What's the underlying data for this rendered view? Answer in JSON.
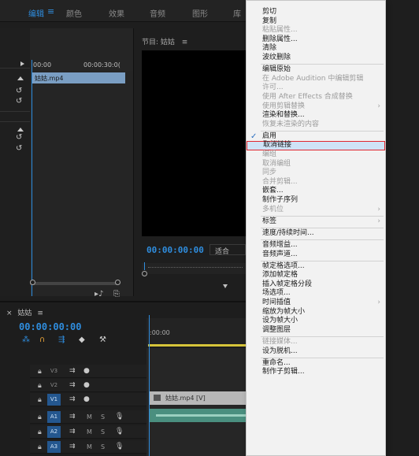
{
  "workspaces": {
    "items": [
      {
        "label": "编辑",
        "active": true
      },
      {
        "label": "颜色",
        "active": false
      },
      {
        "label": "效果",
        "active": false
      },
      {
        "label": "音频",
        "active": false
      },
      {
        "label": "图形",
        "active": false
      },
      {
        "label": "库",
        "active": false
      }
    ],
    "menu_icon": "≡"
  },
  "effect_controls": {
    "ruler_start": "00:00",
    "ruler_end": "00:00:30:0(",
    "clip_name": "姑姑.mp4"
  },
  "program_monitor": {
    "title": "节目: 姑姑",
    "menu_icon": "≡",
    "timecode": "00:00:00:00",
    "fit_label": "适合"
  },
  "timeline": {
    "tab_label": "姑姑",
    "tab_menu_icon": "≡",
    "close_icon": "×",
    "timecode": "00:00:00:00",
    "ruler_timecode": ":00:00",
    "tracks": [
      {
        "id": "V3",
        "type": "video",
        "targeted": false
      },
      {
        "id": "V2",
        "type": "video",
        "targeted": false
      },
      {
        "id": "V1",
        "type": "video",
        "targeted": true
      },
      {
        "id": "A1",
        "type": "audio",
        "targeted": true
      },
      {
        "id": "A2",
        "type": "audio",
        "targeted": true
      },
      {
        "id": "A3",
        "type": "audio",
        "targeted": true
      }
    ],
    "audio_mute_label": "M",
    "audio_solo_label": "S",
    "video_clip_label": "姑姑.mp4 [V]"
  },
  "context_menu": {
    "items": [
      {
        "label": "剪切",
        "enabled": true
      },
      {
        "label": "复制",
        "enabled": true
      },
      {
        "label": "粘贴属性...",
        "enabled": false
      },
      {
        "label": "删除属性...",
        "enabled": true
      },
      {
        "label": "清除",
        "enabled": true
      },
      {
        "label": "波纹删除",
        "enabled": true
      },
      {
        "separator": true
      },
      {
        "label": "编辑原始",
        "enabled": true
      },
      {
        "label": "在 Adobe Audition 中编辑剪辑",
        "enabled": false
      },
      {
        "label": "许可...",
        "enabled": false
      },
      {
        "label": "使用 After Effects 合成替换",
        "enabled": false
      },
      {
        "label": "使用剪辑替换",
        "enabled": false,
        "submenu": true
      },
      {
        "label": "渲染和替换...",
        "enabled": true
      },
      {
        "label": "恢复未渲染的内容",
        "enabled": false
      },
      {
        "separator": true
      },
      {
        "label": "启用",
        "enabled": true,
        "checked": true
      },
      {
        "label": "取消链接",
        "enabled": true,
        "highlighted": true
      },
      {
        "label": "编组",
        "enabled": false
      },
      {
        "label": "取消编组",
        "enabled": false
      },
      {
        "label": "同步",
        "enabled": false
      },
      {
        "label": "合并剪辑...",
        "enabled": false
      },
      {
        "label": "嵌套...",
        "enabled": true
      },
      {
        "label": "制作子序列",
        "enabled": true
      },
      {
        "label": "多机位",
        "enabled": false,
        "submenu": true
      },
      {
        "separator": true
      },
      {
        "label": "标签",
        "enabled": true,
        "submenu": true
      },
      {
        "separator": true
      },
      {
        "label": "速度/持续时间...",
        "enabled": true
      },
      {
        "separator": true
      },
      {
        "label": "音频增益...",
        "enabled": true
      },
      {
        "label": "音频声道...",
        "enabled": true
      },
      {
        "separator": true
      },
      {
        "label": "帧定格选项...",
        "enabled": true
      },
      {
        "label": "添加帧定格",
        "enabled": true
      },
      {
        "label": "插入帧定格分段",
        "enabled": true
      },
      {
        "label": "场选项...",
        "enabled": true
      },
      {
        "label": "时间插值",
        "enabled": true,
        "submenu": true
      },
      {
        "label": "缩放为帧大小",
        "enabled": true
      },
      {
        "label": "设为帧大小",
        "enabled": true
      },
      {
        "label": "调整图层",
        "enabled": true
      },
      {
        "separator": true
      },
      {
        "label": "链接媒体...",
        "enabled": false
      },
      {
        "label": "设为脱机...",
        "enabled": true
      },
      {
        "separator": true
      },
      {
        "label": "重命名...",
        "enabled": true
      },
      {
        "label": "制作子剪辑...",
        "enabled": true
      }
    ]
  },
  "colors": {
    "accent_blue": "#2f8dde",
    "highlight_border": "#e0272f",
    "highlight_fill": "#cfe3f7",
    "work_area": "#d6c43a",
    "audio_clip": "#4a8f7f",
    "video_clip": "#b7b7b7"
  }
}
